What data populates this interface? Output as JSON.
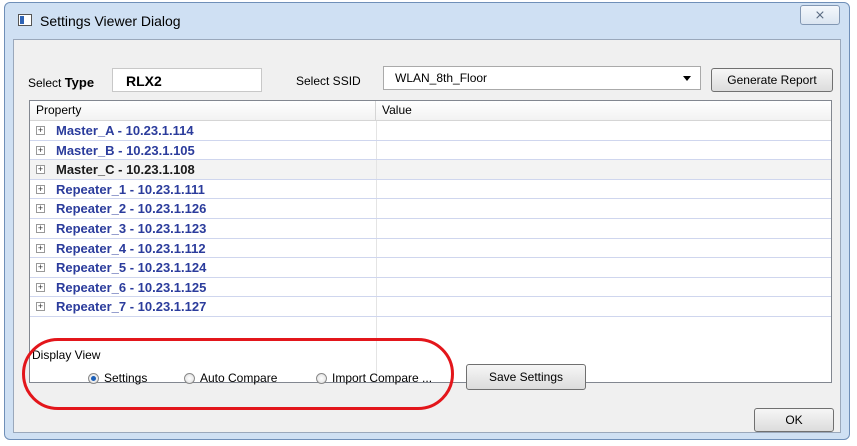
{
  "window": {
    "title": "Settings Viewer Dialog",
    "close_glyph": "⨯"
  },
  "select_type": {
    "label_prefix": "Select ",
    "label_bold": "Type",
    "value": "RLX2"
  },
  "select_ssid": {
    "label": "Select SSID",
    "value": "WLAN_8th_Floor"
  },
  "buttons": {
    "generate_report": "Generate Report",
    "save_settings": "Save Settings",
    "ok": "OK"
  },
  "grid": {
    "columns": [
      "Property",
      "Value"
    ],
    "expander_glyph": "+",
    "rows": [
      {
        "label": "Master_A - 10.23.1.114",
        "selected": false
      },
      {
        "label": "Master_B - 10.23.1.105",
        "selected": false
      },
      {
        "label": "Master_C - 10.23.1.108",
        "selected": true
      },
      {
        "label": "Repeater_1 - 10.23.1.111",
        "selected": false
      },
      {
        "label": "Repeater_2 - 10.23.1.126",
        "selected": false
      },
      {
        "label": "Repeater_3 - 10.23.1.123",
        "selected": false
      },
      {
        "label": "Repeater_4 - 10.23.1.112",
        "selected": false
      },
      {
        "label": "Repeater_5 - 10.23.1.124",
        "selected": false
      },
      {
        "label": "Repeater_6 - 10.23.1.125",
        "selected": false
      },
      {
        "label": "Repeater_7 - 10.23.1.127",
        "selected": false
      }
    ]
  },
  "display_view": {
    "label": "Display View",
    "options": [
      {
        "label": "Settings",
        "checked": true
      },
      {
        "label": "Auto Compare",
        "checked": false
      },
      {
        "label": "Import Compare ...",
        "checked": false
      }
    ]
  },
  "colors": {
    "annotation_ellipse": "#e3161b",
    "row_text": "#2b3c9c",
    "dialog_frame": "#cfe0f3"
  }
}
